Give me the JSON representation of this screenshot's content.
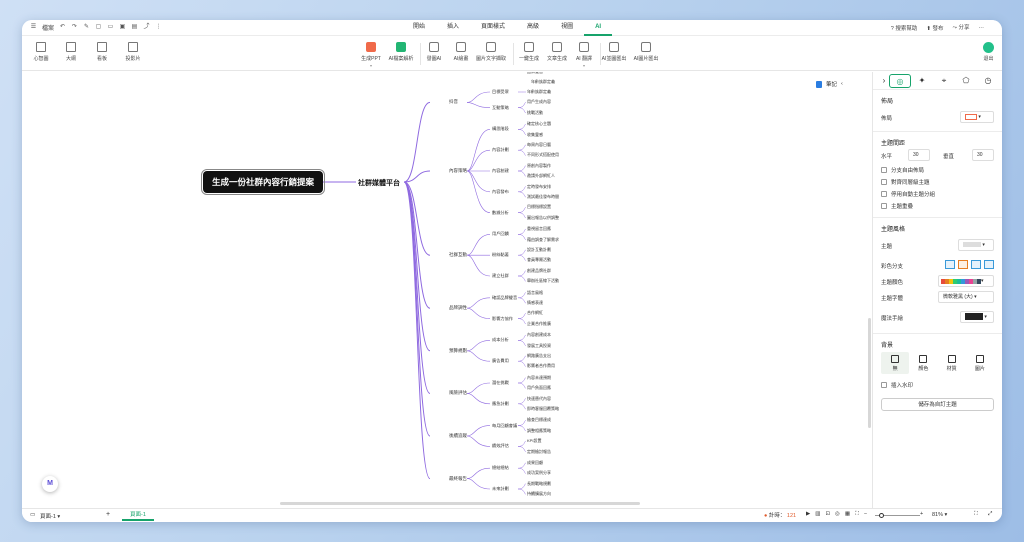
{
  "titlebar": {
    "file_label": "檔案",
    "tabs": [
      "開始",
      "插入",
      "頁面樣式",
      "高級",
      "視圖",
      "AI"
    ],
    "active_tab": "AI",
    "right_items": [
      "搜索幫助",
      "發布",
      "分享"
    ]
  },
  "ribbon": {
    "left_buttons": [
      "心智圖",
      "大綱",
      "看板",
      "投影片"
    ],
    "ai_buttons": [
      "生成PPT",
      "AI檔案解析",
      "發圖AI",
      "AI繪畫",
      "圖片文字擷取",
      "一鍵生成",
      "文章生成",
      "AI 翻譯",
      "AI並圖匯出",
      "AI圖片匯出"
    ],
    "exit_label": "退出"
  },
  "canvas": {
    "note_label": "筆記",
    "root": "生成一份社群內容行銷提案",
    "level1": "社群媒體平台",
    "partial_top": [
      "品牌聲音",
      "年齡族群定義"
    ],
    "branches": [
      {
        "label": "抖音",
        "children": [
          {
            "label": "目標受眾",
            "leaves": [
              "年齡族群定義"
            ]
          },
          {
            "label": "互動策略",
            "leaves": [
              "用戶生成內容",
              "挑戰活動"
            ]
          }
        ]
      },
      {
        "label": "內容策略",
        "children": [
          {
            "label": "構思階段",
            "leaves": [
              "確定核心主題",
              "收集靈感"
            ]
          },
          {
            "label": "內容計劃",
            "leaves": [
              "每周內容日曆",
              "不同形式搭配使用"
            ]
          },
          {
            "label": "內容創建",
            "leaves": [
              "原創內容製作",
              "邀請外部網紅人"
            ]
          },
          {
            "label": "內容發布",
            "leaves": [
              "定時發布安排",
              "測試最佳發布時間"
            ]
          },
          {
            "label": "數據分析",
            "leaves": [
              "目標指標設置",
              "圖出報告以供調整"
            ]
          }
        ]
      },
      {
        "label": "社群互動",
        "children": [
          {
            "label": "用戶回饋",
            "leaves": [
              "重視留言回應",
              "藉由調查了解需求"
            ]
          },
          {
            "label": "粉絲黏著",
            "leaves": [
              "設計互動計劃",
              "會員專屬活動"
            ]
          },
          {
            "label": "建立社群",
            "leaves": [
              "創建品牌社群",
              "舉辦社區線下活動"
            ]
          }
        ]
      },
      {
        "label": "品牌調性",
        "children": [
          {
            "label": "確認品牌聲音",
            "leaves": [
              "語言風格",
              "情感表達"
            ]
          },
          {
            "label": "影響力協作",
            "leaves": [
              "合作網紅",
              "企業合作推廣"
            ]
          }
        ]
      },
      {
        "label": "預算規劃",
        "children": [
          {
            "label": "成本分析",
            "leaves": [
              "內容創建成本",
              "發展工具投資"
            ]
          },
          {
            "label": "廣告費用",
            "leaves": [
              "網路廣告支出",
              "影響者合作費用"
            ]
          }
        ]
      },
      {
        "label": "風險評估",
        "children": [
          {
            "label": "潛在挑戰",
            "leaves": [
              "內容未達預期",
              "用戶負面回應"
            ]
          },
          {
            "label": "應急計劃",
            "leaves": [
              "快速替代內容",
              "即時客服回覆策略"
            ]
          }
        ]
      },
      {
        "label": "後續追蹤",
        "children": [
          {
            "label": "每月回顧會議",
            "leaves": [
              "檢查目標達成",
              "調整相應策略"
            ]
          },
          {
            "label": "績效評估",
            "leaves": [
              "KPI設置",
              "定期檢討報告"
            ]
          }
        ]
      },
      {
        "label": "最終報告",
        "children": [
          {
            "label": "總結總結",
            "leaves": [
              "成果回顧",
              "成功案例分享"
            ]
          },
          {
            "label": "未來計劃",
            "leaves": [
              "長期戰略規劃",
              "持續擴展方向"
            ]
          }
        ]
      }
    ]
  },
  "panel": {
    "section_layout": "佈局",
    "layout_label": "佈局",
    "spacing_title": "主題間距",
    "h_label": "水平",
    "h_value": "30",
    "v_label": "垂直",
    "v_value": "30",
    "checks": [
      "分支自由佈局",
      "對齊同層級主題",
      "停用自動主題分組",
      "主題重疊"
    ],
    "style_title": "主題風格",
    "theme_label": "主題",
    "color_branch_label": "彩色分支",
    "theme_color_label": "主題顏色",
    "font_label": "主題字體",
    "font_value": "微軟雅黑 (大)",
    "hand_label": "魔法手繪",
    "bg_title": "背景",
    "bg_options": [
      "無",
      "顏色",
      "材質",
      "圖片"
    ],
    "watermark_label": "插入水印",
    "save_theme_label": "儲存為自訂主題",
    "palette": [
      "#e74c3c",
      "#e67e22",
      "#f1c40f",
      "#2ecc71",
      "#1abc9c",
      "#3498db",
      "#9b59b6",
      "#e84393",
      "#95a5a6",
      "#34495e"
    ]
  },
  "statusbar": {
    "page_label": "頁面-1",
    "page_tab": "頁面-1",
    "count_label": "計時：",
    "count_value": "121",
    "zoom": "81%"
  }
}
